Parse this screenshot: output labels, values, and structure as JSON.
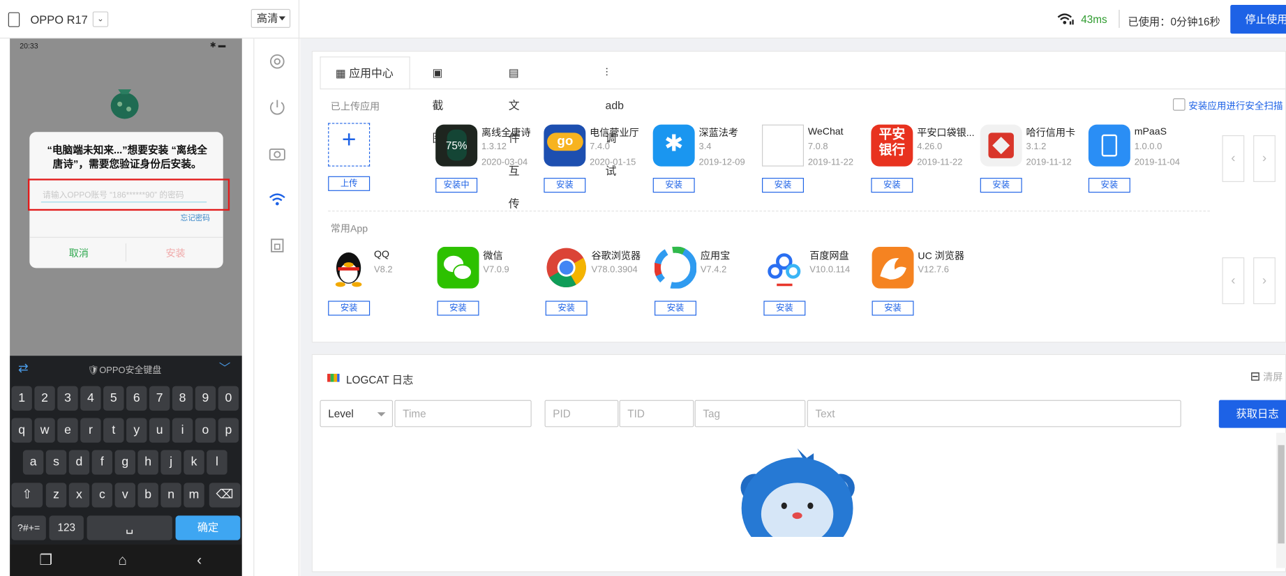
{
  "topbar": {
    "device_name": "OPPO R17",
    "quality": "高清",
    "latency": "43ms",
    "used_time": "已使用：0分钟16秒",
    "stop_label": "停止使用"
  },
  "phone": {
    "status_time": "20:33",
    "dialog_message": "“电脑端未知来...”想要安装 “离线全唐诗”，需要您验证身份后安装。",
    "password_placeholder": "请输入OPPO账号 “186******90” 的密码",
    "forgot_password": "忘记密码",
    "cancel": "取消",
    "install": "安装",
    "keyboard_title": "OPPO安全键盘",
    "row_digits": [
      "1",
      "2",
      "3",
      "4",
      "5",
      "6",
      "7",
      "8",
      "9",
      "0"
    ],
    "row_q": [
      "q",
      "w",
      "e",
      "r",
      "t",
      "y",
      "u",
      "i",
      "o",
      "p"
    ],
    "row_a": [
      "a",
      "s",
      "d",
      "f",
      "g",
      "h",
      "j",
      "k",
      "l"
    ],
    "row_z": [
      "z",
      "x",
      "c",
      "v",
      "b",
      "n",
      "m"
    ],
    "sym_key": "?#+=",
    "num_key": "123",
    "confirm_key": "确定"
  },
  "tabs": [
    "应用中心",
    "截图",
    "文件互传",
    "adb调试"
  ],
  "uploaded": {
    "label": "已上传应用",
    "scan_label": "安装应用进行安全扫描",
    "upload_label": "上传",
    "progress": "75%",
    "apps": [
      {
        "name": "离线全唐诗",
        "version": "1.3.12",
        "date": "2020-03-04",
        "button": "安装中"
      },
      {
        "name": "电信营业厅",
        "version": "7.4.0",
        "date": "2020-01-15",
        "button": "安装"
      },
      {
        "name": "深蓝法考",
        "version": "3.4",
        "date": "2019-12-09",
        "button": "安装"
      },
      {
        "name": "WeChat",
        "version": "7.0.8",
        "date": "2019-11-22",
        "button": "安装"
      },
      {
        "name": "平安口袋银...",
        "version": "4.26.0",
        "date": "2019-11-22",
        "button": "安装"
      },
      {
        "name": "哈行信用卡",
        "version": "3.1.2",
        "date": "2019-11-12",
        "button": "安装"
      },
      {
        "name": "mPaaS",
        "version": "1.0.0.0",
        "date": "2019-11-04",
        "button": "安装"
      }
    ],
    "pingan_text": [
      "平安",
      "银行"
    ]
  },
  "common": {
    "label": "常用App",
    "apps": [
      {
        "name": "QQ",
        "version": "V8.2",
        "button": "安装"
      },
      {
        "name": "微信",
        "version": "V7.0.9",
        "button": "安装"
      },
      {
        "name": "谷歌浏览器",
        "version": "V78.0.3904",
        "button": "安装"
      },
      {
        "name": "应用宝",
        "version": "V7.4.2",
        "button": "安装"
      },
      {
        "name": "百度网盘",
        "version": "V10.0.114",
        "button": "安装"
      },
      {
        "name": "UC 浏览器",
        "version": "V12.7.6",
        "button": "安装"
      }
    ]
  },
  "logcat": {
    "title": "LOGCAT 日志",
    "clear": "清屏",
    "level": "Level",
    "time": "Time",
    "pid": "PID",
    "tid": "TID",
    "tag": "Tag",
    "text": "Text",
    "get_log": "获取日志"
  },
  "colors": {
    "accent": "#1d62e6",
    "latency": "#2e9b2e",
    "highlight": "#e21b1b"
  }
}
